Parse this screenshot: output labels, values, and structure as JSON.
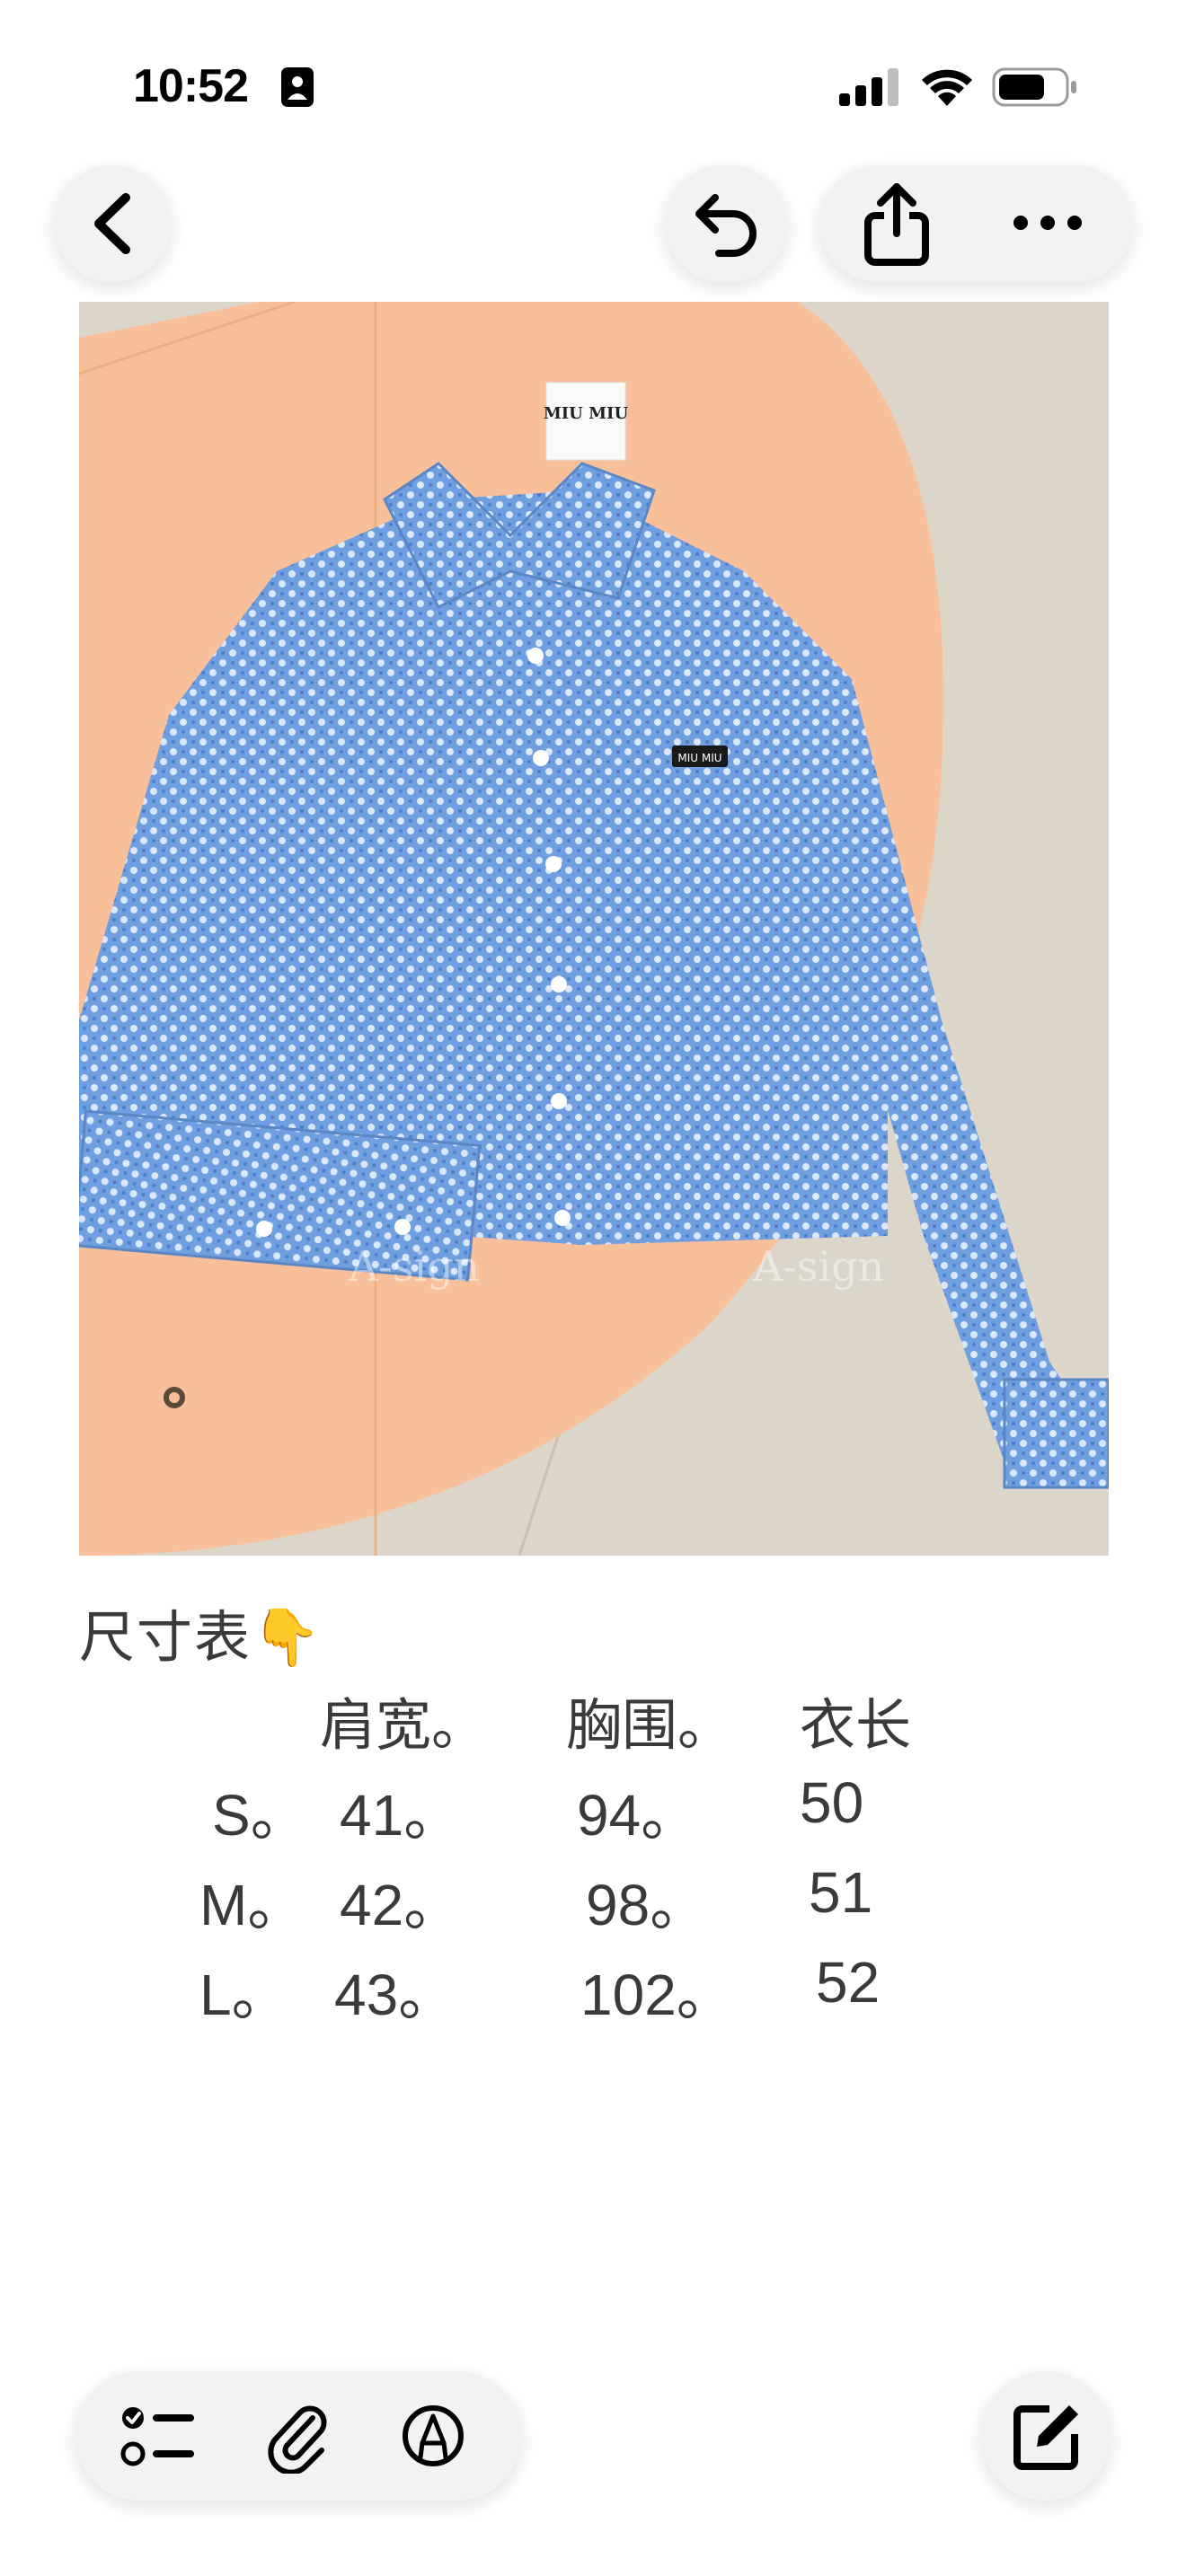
{
  "status_bar": {
    "time": "10:52",
    "icons": [
      "id-card-icon",
      "cellular-signal-icon",
      "wifi-icon",
      "battery-icon"
    ]
  },
  "toolbar_top": {
    "left": [
      "back-chevron-icon"
    ],
    "right": [
      "undo-icon",
      "share-icon",
      "more-icon"
    ]
  },
  "photo": {
    "subject": "blue knit cropped shirt on peach garment bag",
    "brand_tag_text": "MIU MIU",
    "watermark": "A-sign",
    "colors": {
      "shirt": "#6f9fe0",
      "bag": "#f7c09a",
      "floor": "#dcd6ca"
    }
  },
  "note": {
    "heading": "尺寸表👇",
    "table": {
      "headers": [
        "肩宽。",
        "胸围。",
        "衣长"
      ],
      "rows": [
        {
          "size": "S。",
          "values": [
            "41。",
            "94。",
            "50"
          ]
        },
        {
          "size": "M。",
          "values": [
            "42。",
            "98。",
            "51"
          ]
        },
        {
          "size": "L。",
          "values": [
            "43。",
            "102。",
            "52"
          ]
        }
      ]
    }
  },
  "toolbar_bottom": {
    "left": [
      "checklist-icon",
      "paperclip-icon",
      "markup-pen-icon"
    ],
    "right": [
      "compose-icon"
    ]
  }
}
